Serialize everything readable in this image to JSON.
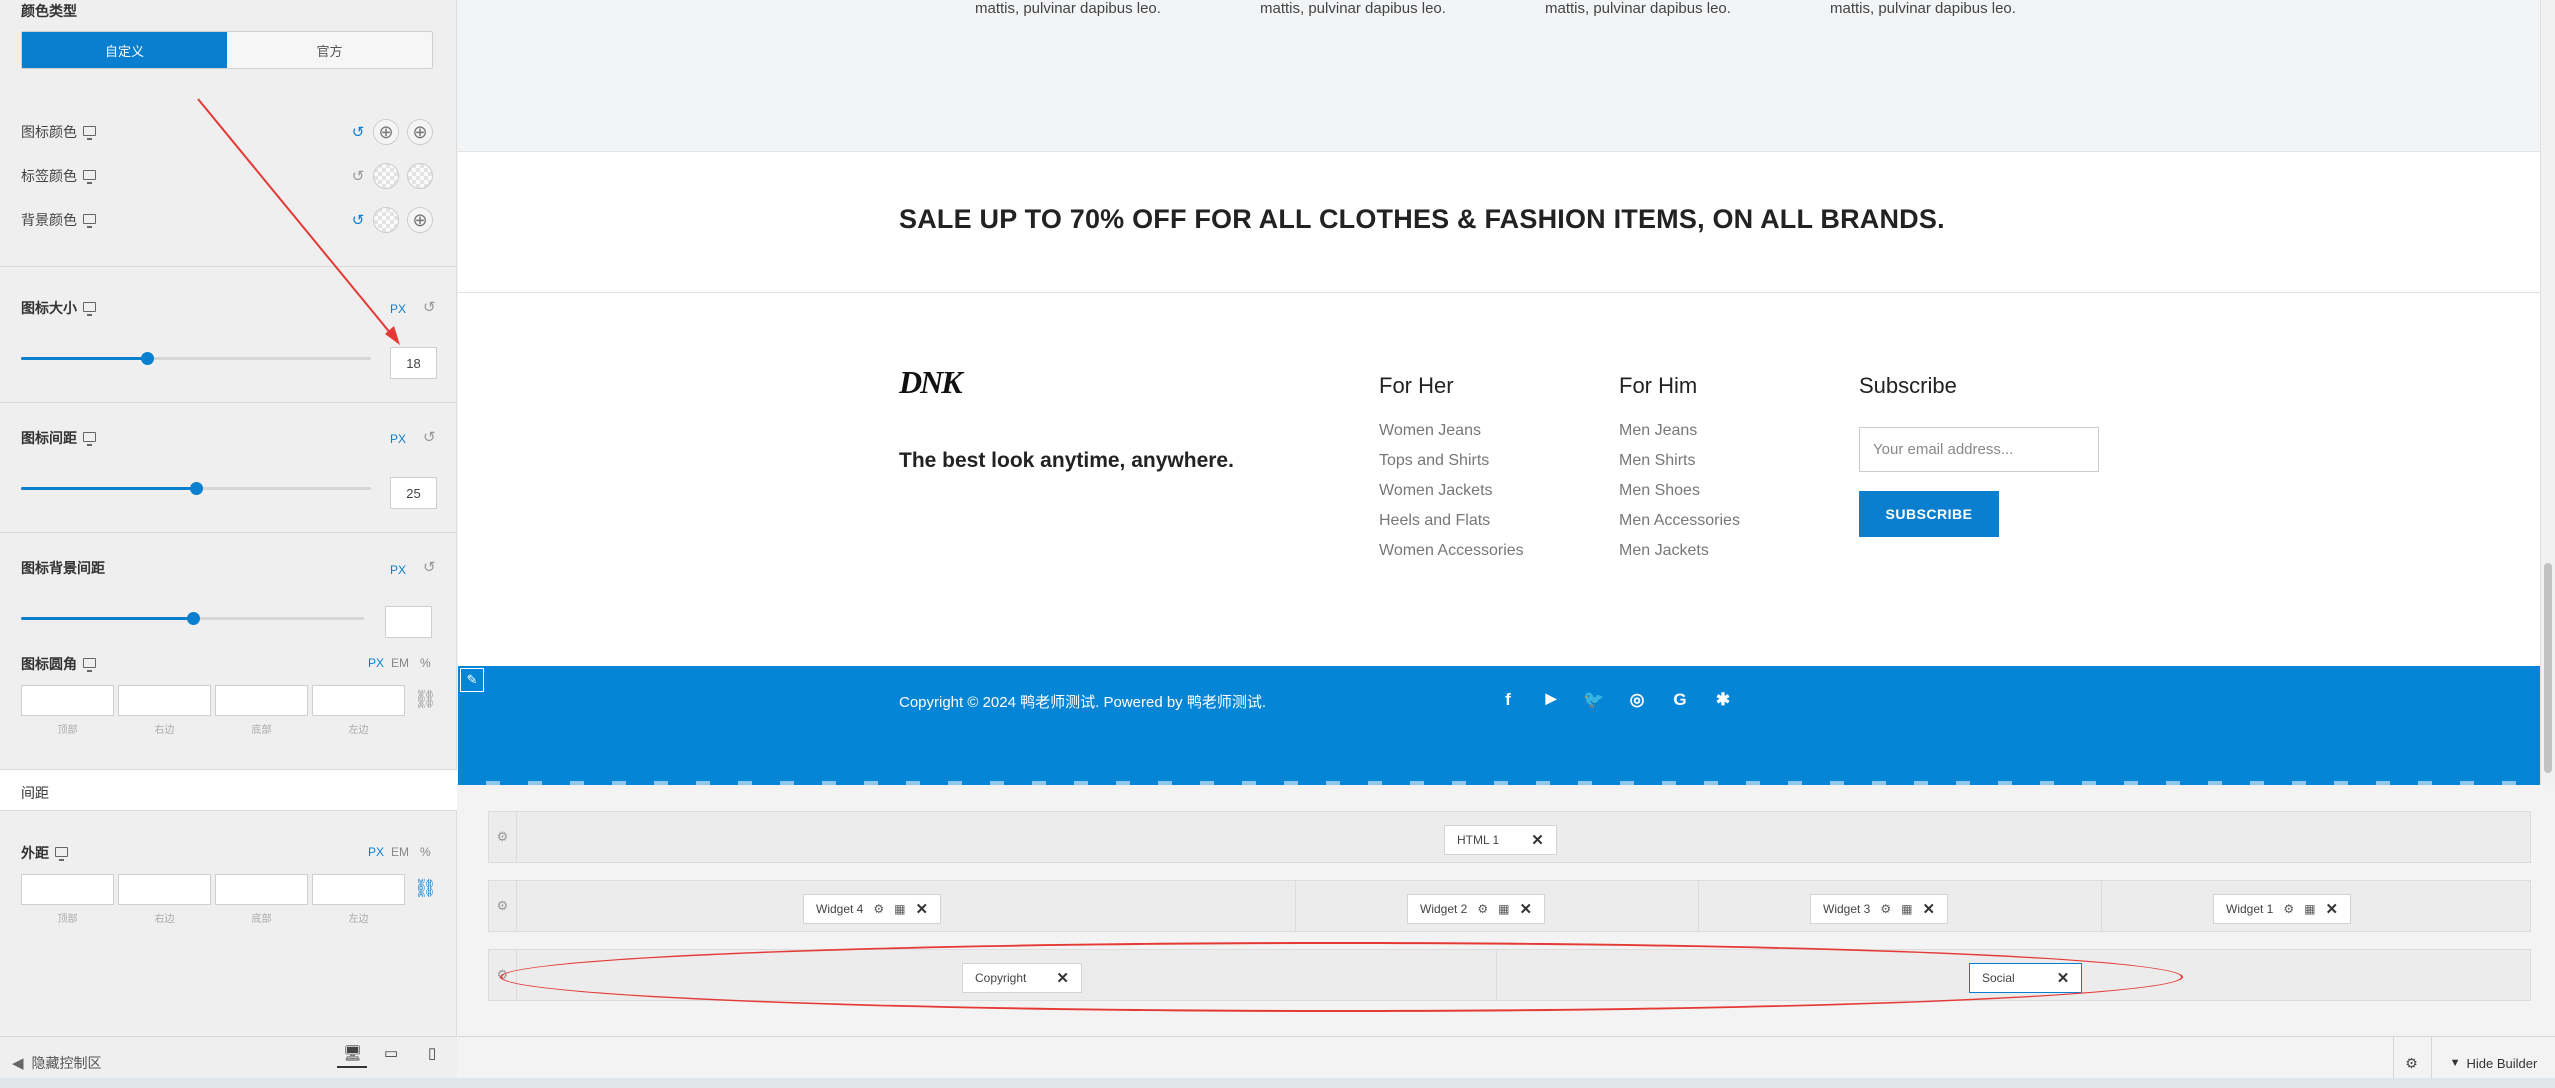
{
  "panel": {
    "color_type_title": "颜色类型",
    "segments": [
      "自定义",
      "官方"
    ],
    "color_rows": [
      {
        "label": "图标颜色"
      },
      {
        "label": "标签颜色"
      },
      {
        "label": "背景颜色"
      }
    ],
    "icon_size": {
      "label": "图标大小",
      "unit": "PX",
      "value": "18",
      "slider_fraction": 0.36
    },
    "icon_spacing": {
      "label": "图标间距",
      "unit": "PX",
      "value": "25",
      "slider_fraction": 0.5
    },
    "icon_bg_spacing": {
      "label": "图标背景间距",
      "unit": "PX",
      "value": "",
      "slider_fraction": 0.5
    },
    "icon_radius": {
      "label": "图标圆角",
      "units": [
        "PX",
        "EM",
        "%"
      ],
      "sides": [
        "顶部",
        "右边",
        "底部",
        "左边"
      ]
    },
    "spacing_tab": "间距",
    "margin": {
      "label": "外距",
      "units": [
        "PX",
        "EM",
        "%"
      ],
      "sides": [
        "顶部",
        "右边",
        "底部",
        "左边"
      ]
    },
    "hide_controls": "隐藏控制区",
    "accent": "#0a7fd0"
  },
  "preview": {
    "lorem_snippets": [
      "mattis, pulvinar dapibus leo.",
      "mattis, pulvinar dapibus leo.",
      "mattis, pulvinar dapibus leo.",
      "mattis, pulvinar dapibus leo."
    ],
    "sale_text": "SALE UP TO 70% OFF FOR ALL CLOTHES & FASHION ITEMS, ON ALL BRANDS.",
    "logo": "DNK",
    "tagline": "The best look anytime, anywhere.",
    "for_her": {
      "title": "For Her",
      "items": [
        "Women Jeans",
        "Tops and Shirts",
        "Women Jackets",
        "Heels and Flats",
        "Women Accessories"
      ]
    },
    "for_him": {
      "title": "For Him",
      "items": [
        "Men Jeans",
        "Men Shirts",
        "Men Shoes",
        "Men Accessories",
        "Men Jackets"
      ]
    },
    "subscribe": {
      "title": "Subscribe",
      "placeholder": "Your email address...",
      "button": "SUBSCRIBE"
    },
    "copyright": "Copyright © 2024 鸭老师测试. Powered by 鸭老师测试.",
    "social_icons": [
      "facebook-icon",
      "youtube-icon",
      "twitter-icon",
      "instagram-icon",
      "google-icon",
      "yelp-icon"
    ],
    "bar_color": "#0585d6"
  },
  "builder": {
    "row1": [
      "HTML 1"
    ],
    "row2": [
      "Widget 4",
      "Widget 2",
      "Widget 3",
      "Widget 1"
    ],
    "row3": [
      "Copyright",
      "Social"
    ],
    "hide_builder": "Hide Builder"
  }
}
